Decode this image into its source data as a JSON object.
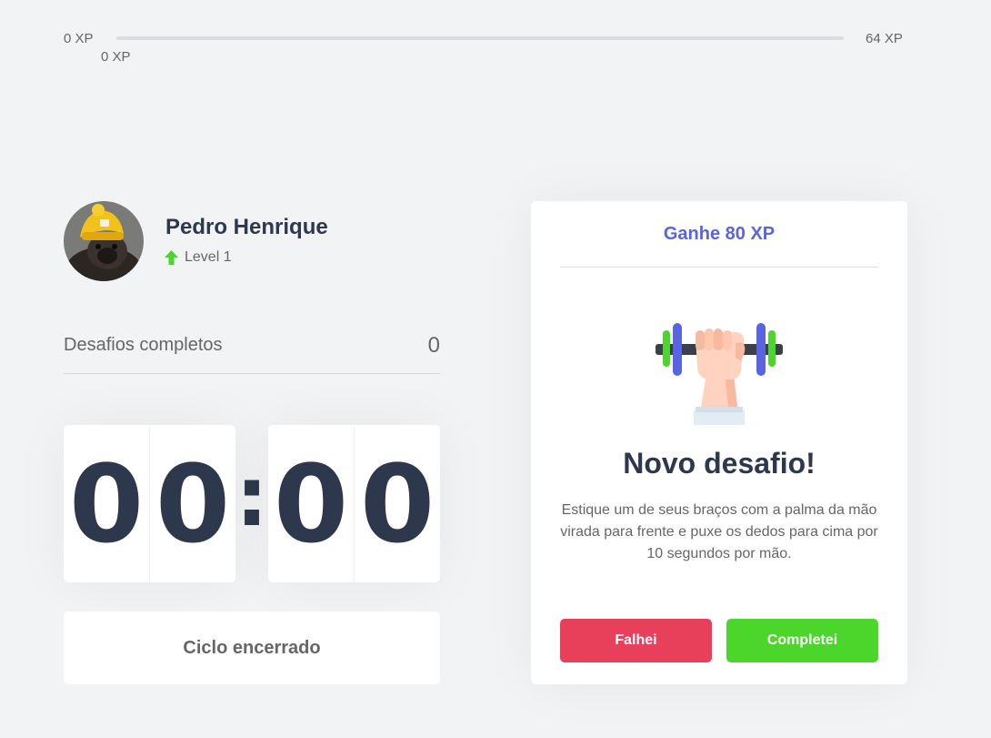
{
  "experience": {
    "min_label": "0 XP",
    "max_label": "64 XP",
    "current_label": "0 XP",
    "progress_fraction": 0,
    "colors": {
      "track": "#dcdde0",
      "fill": "#4cd62b"
    }
  },
  "profile": {
    "name": "Pedro Henrique",
    "level_label": "Level 1",
    "avatar_icon": "pug-avatar-photo",
    "level_icon": "level-up-arrow-icon"
  },
  "completed": {
    "label": "Desafios completos",
    "value": "0"
  },
  "countdown": {
    "minutes": [
      "0",
      "0"
    ],
    "separator": ":",
    "seconds": [
      "0",
      "0"
    ]
  },
  "cycle_button": {
    "label": "Ciclo encerrado"
  },
  "challenge": {
    "header": "Ganhe 80 XP",
    "icon": "dumbbell-arm-icon",
    "title": "Novo desafio!",
    "description": "Estique um de seus braços com a palma da mão virada para frente e puxe os dedos para cima por 10 segundos por mão.",
    "fail_label": "Falhei",
    "success_label": "Completei"
  },
  "colors": {
    "background": "#f2f3f5",
    "title": "#2e384d",
    "text": "#666666",
    "accent": "#5965e0",
    "red": "#e83f5b",
    "green": "#4cd62b"
  }
}
